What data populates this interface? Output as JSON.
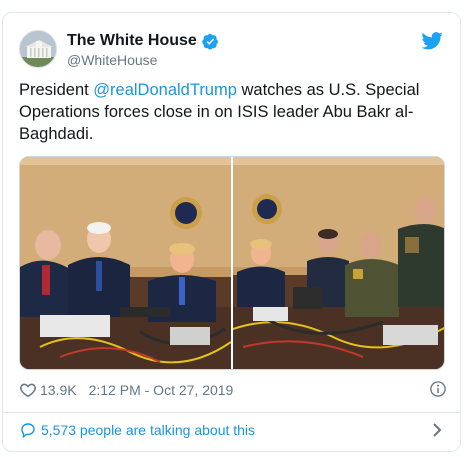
{
  "tweet": {
    "display_name": "The White House",
    "handle": "@WhiteHouse",
    "text_before": "President ",
    "mention": "@realDonaldTrump",
    "text_after": " watches as U.S. Special Operations forces close in on ISIS leader Abu Bakr al-Baghdadi.",
    "like_count": "13.9K",
    "timestamp": "2:12 PM - Oct 27, 2019",
    "talking_text": "5,573 people are talking about this"
  },
  "icons": {
    "verified": "verified-badge-icon",
    "twitter": "twitter-bird-icon",
    "like": "heart-icon",
    "info": "info-icon",
    "reply": "comment-icon",
    "chevron": "chevron-right-icon"
  },
  "colors": {
    "link": "#1b95e0",
    "secondary_text": "#657786",
    "border": "#e1e8ed"
  }
}
